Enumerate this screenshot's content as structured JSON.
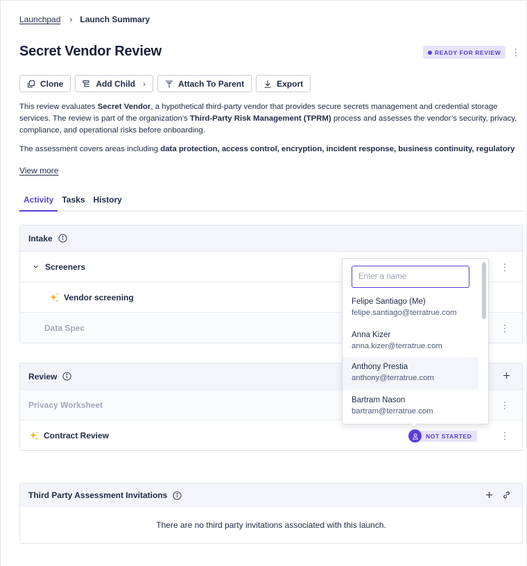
{
  "breadcrumb": {
    "parent": "Launchpad",
    "separator": "›",
    "current": "Launch Summary"
  },
  "page": {
    "title": "Secret Vendor Review",
    "status": "READY FOR REVIEW",
    "more_icon": "kebab-vertical-icon"
  },
  "toolbar": {
    "clone": "Clone",
    "add_child": "Add Child",
    "attach_to_parent": "Attach To Parent",
    "export": "Export"
  },
  "description": {
    "p1_a": "This review evaluates ",
    "p1_b": "Secret Vendor",
    "p1_c": ", a hypothetical third-party vendor that provides secure secrets management and credential storage services. The review is part of the organization’s ",
    "p1_d": "Third-Party Risk Management (TPRM)",
    "p1_e": " process and assesses the vendor’s security, privacy, compliance, and operational risks before onboarding.",
    "p2_a": "The assessment covers areas including ",
    "p2_b": "data protection, access control, encryption, incident response, business continuity, regulatory",
    "view_more": "View more"
  },
  "tabs": [
    {
      "label": "Activity",
      "active": true
    },
    {
      "label": "Tasks",
      "active": false
    },
    {
      "label": "History",
      "active": false
    }
  ],
  "intake": {
    "title": "Intake",
    "screeners": "Screeners",
    "vendor_screening": "Vendor screening",
    "data_spec": "Data Spec"
  },
  "review": {
    "title": "Review",
    "privacy_worksheet": "Privacy Worksheet",
    "contract_review": "Contract Review",
    "contract_status": "NOT STARTED"
  },
  "invitations": {
    "title": "Third Party Assessment Invitations",
    "empty": "There are no third party invitations associated with this launch."
  },
  "assignee_dropdown": {
    "placeholder": "Enter a name",
    "people": [
      {
        "name": "Felipe Santiago (Me)",
        "email": "felipe.santiago@terratrue.com"
      },
      {
        "name": "Anna Kizer",
        "email": "anna.kizer@terratrue.com"
      },
      {
        "name": "Anthony Prestia",
        "email": "anthony@terratrue.com"
      },
      {
        "name": "Bartram Nason",
        "email": "bartram@terratrue.com"
      }
    ]
  },
  "colors": {
    "accent": "#5b3fd1",
    "accent_bg": "#e7e3fb",
    "sparkle": "#f0b51c",
    "text": "#1f2a44",
    "muted": "#a2a8b6"
  }
}
